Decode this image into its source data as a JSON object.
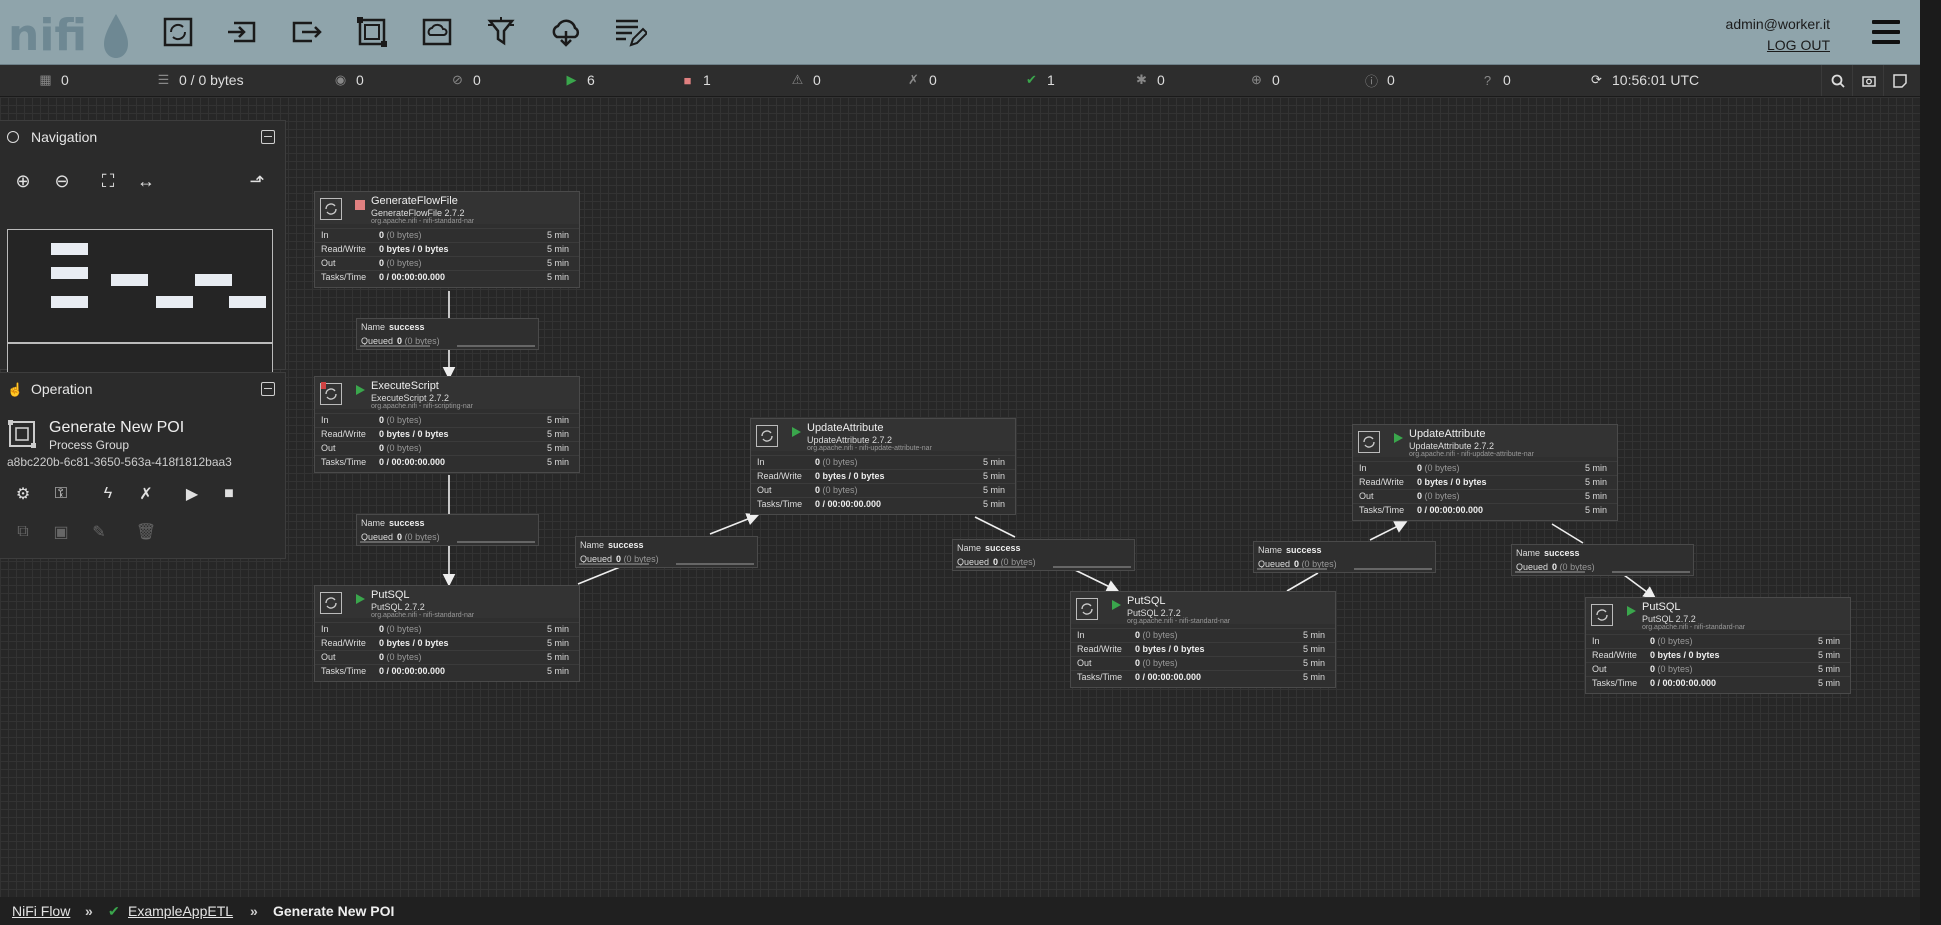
{
  "header": {
    "logo_text": "nifi",
    "user": "admin@worker.it",
    "logout_label": "LOG OUT"
  },
  "status_bar": {
    "active_threads": "0",
    "queued": "0 / 0 bytes",
    "transmitting": "0",
    "not_transmitting": "0",
    "running": "6",
    "stopped": "1",
    "invalid": "0",
    "disabled": "0",
    "up_to_date": "1",
    "locally_modified": "0",
    "stale": "0",
    "errors": "0",
    "sync_failure": "0",
    "last_refresh": "10:56:01 UTC"
  },
  "navigation": {
    "title": "Navigation"
  },
  "operation": {
    "title": "Operation",
    "group_name": "Generate New POI",
    "group_type": "Process Group",
    "group_id": "a8bc220b-6c81-3650-563a-418f1812baa3"
  },
  "processors": [
    {
      "name": "GenerateFlowFile",
      "type": "GenerateFlowFile 2.7.2",
      "bundle": "org.apache.nifi - nifi-standard-nar",
      "state": "stopped",
      "in_count": "0",
      "in_bytes": "(0 bytes)",
      "rw": "0 bytes / 0 bytes",
      "out_count": "0",
      "out_bytes": "(0 bytes)",
      "tasks": "0 / 00:00:00.000",
      "window": "5 min"
    },
    {
      "name": "ExecuteScript",
      "type": "ExecuteScript 2.7.2",
      "bundle": "org.apache.nifi - nifi-scripting-nar",
      "state": "running",
      "in_count": "0",
      "in_bytes": "(0 bytes)",
      "rw": "0 bytes / 0 bytes",
      "out_count": "0",
      "out_bytes": "(0 bytes)",
      "tasks": "0 / 00:00:00.000",
      "window": "5 min"
    },
    {
      "name": "PutSQL",
      "type": "PutSQL 2.7.2",
      "bundle": "org.apache.nifi - nifi-standard-nar",
      "state": "running",
      "in_count": "0",
      "in_bytes": "(0 bytes)",
      "rw": "0 bytes / 0 bytes",
      "out_count": "0",
      "out_bytes": "(0 bytes)",
      "tasks": "0 / 00:00:00.000",
      "window": "5 min"
    },
    {
      "name": "UpdateAttribute",
      "type": "UpdateAttribute 2.7.2",
      "bundle": "org.apache.nifi - nifi-update-attribute-nar",
      "state": "running",
      "in_count": "0",
      "in_bytes": "(0 bytes)",
      "rw": "0 bytes / 0 bytes",
      "out_count": "0",
      "out_bytes": "(0 bytes)",
      "tasks": "0 / 00:00:00.000",
      "window": "5 min"
    },
    {
      "name": "PutSQL",
      "type": "PutSQL 2.7.2",
      "bundle": "org.apache.nifi - nifi-standard-nar",
      "state": "running",
      "in_count": "0",
      "in_bytes": "(0 bytes)",
      "rw": "0 bytes / 0 bytes",
      "out_count": "0",
      "out_bytes": "(0 bytes)",
      "tasks": "0 / 00:00:00.000",
      "window": "5 min"
    },
    {
      "name": "UpdateAttribute",
      "type": "UpdateAttribute 2.7.2",
      "bundle": "org.apache.nifi - nifi-update-attribute-nar",
      "state": "running",
      "in_count": "0",
      "in_bytes": "(0 bytes)",
      "rw": "0 bytes / 0 bytes",
      "out_count": "0",
      "out_bytes": "(0 bytes)",
      "tasks": "0 / 00:00:00.000",
      "window": "5 min"
    },
    {
      "name": "PutSQL",
      "type": "PutSQL 2.7.2",
      "bundle": "org.apache.nifi - nifi-standard-nar",
      "state": "running",
      "in_count": "0",
      "in_bytes": "(0 bytes)",
      "rw": "0 bytes / 0 bytes",
      "out_count": "0",
      "out_bytes": "(0 bytes)",
      "tasks": "0 / 00:00:00.000",
      "window": "5 min"
    }
  ],
  "row_labels": {
    "in": "In",
    "rw": "Read/Write",
    "out": "Out",
    "tasks": "Tasks/Time"
  },
  "connections": [
    {
      "name_label": "Name",
      "name": "success",
      "queued_label": "Queued",
      "queued_count": "0",
      "queued_bytes": "(0 bytes)"
    },
    {
      "name_label": "Name",
      "name": "success",
      "queued_label": "Queued",
      "queued_count": "0",
      "queued_bytes": "(0 bytes)"
    },
    {
      "name_label": "Name",
      "name": "success",
      "queued_label": "Queued",
      "queued_count": "0",
      "queued_bytes": "(0 bytes)"
    },
    {
      "name_label": "Name",
      "name": "success",
      "queued_label": "Queued",
      "queued_count": "0",
      "queued_bytes": "(0 bytes)"
    },
    {
      "name_label": "Name",
      "name": "success",
      "queued_label": "Queued",
      "queued_count": "0",
      "queued_bytes": "(0 bytes)"
    },
    {
      "name_label": "Name",
      "name": "success",
      "queued_label": "Queued",
      "queued_count": "0",
      "queued_bytes": "(0 bytes)"
    }
  ],
  "breadcrumbs": {
    "root": "NiFi Flow",
    "sep": "»",
    "parent": "ExampleAppETL",
    "current": "Generate New POI"
  },
  "colors": {
    "header_bg": "#8fa4ab",
    "running": "#3aa64c",
    "stopped": "#e08080",
    "canvas": "#272727"
  }
}
